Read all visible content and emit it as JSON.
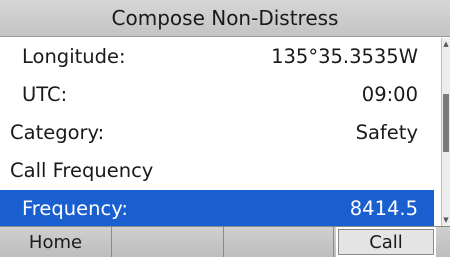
{
  "title": "Compose Non-Distress",
  "rows": [
    {
      "label": "Longitude:",
      "value": "135°35.3535W"
    },
    {
      "label": "UTC:",
      "value": "09:00"
    },
    {
      "label": "Category:",
      "value": "Safety"
    },
    {
      "label": "Call Frequency",
      "value": ""
    },
    {
      "label": "Frequency:",
      "value": "8414.5"
    }
  ],
  "softkeys": [
    "Home",
    "",
    "",
    "Call"
  ],
  "colors": {
    "selection": "#1a5fcf",
    "title_bar": "#c8c8c8"
  }
}
